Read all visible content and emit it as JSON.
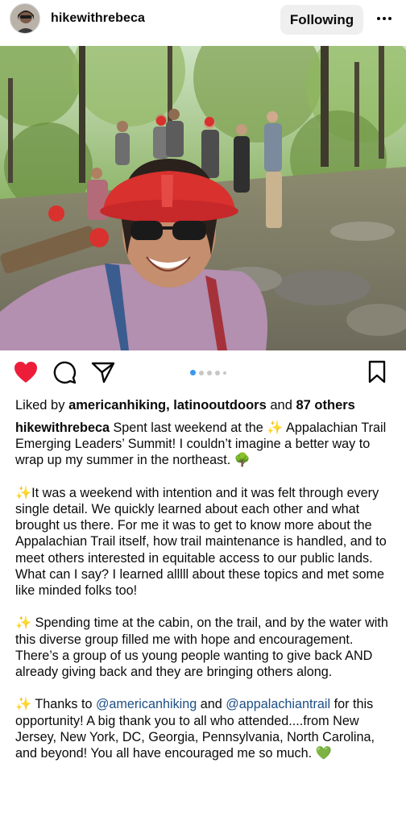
{
  "post": {
    "username": "hikewithrebeca",
    "follow_label": "Following",
    "more_icon": "more-horizontal-icon",
    "photo_description": "",
    "liked_prefix": "Liked by",
    "liked_users": "americanhiking, latinooutdoors",
    "liked_and": "and",
    "liked_others": "87 others",
    "carousel": {
      "count": 5,
      "active": 1
    },
    "colors": {
      "like_red": "#ed1d3a",
      "link_blue": "#1d4f86",
      "carousel_blue": "#3897f0",
      "button_bg": "#efefef"
    }
  },
  "caption": {
    "p1_user": "hikewithrebeca",
    "p1_a": "Spent last weekend at the",
    "p1_b": "Appalachian Trail Emerging Leaders’ Summit! I couldn’t imagine a better way to wrap up my summer in the northeast.",
    "p2": "It was a weekend with intention and it was felt through every single detail. We quickly learned about each other and what brought us there. For me it was to get to know more about the Appalachian Trail itself, how trail maintenance is handled, and to meet others interested in equitable access to our public lands. What can I say? I learned alllll about these topics and met some like minded folks too!",
    "p3": "Spending time at the cabin, on the trail, and by the water with this diverse group filled me with hope and encouragement. There’s a group of us young people wanting to give back AND already giving back and they are bringing others along.",
    "p4_a": "Thanks to",
    "p4_m1": "@americanhiking",
    "p4_and": "and",
    "p4_m2": "@appalachiantrail",
    "p4_b": "for this opportunity! A big thank you to all who attended....from New Jersey, New York, DC, Georgia, Pennsylvania, North Carolina, and beyond! You all have encouraged me so much.",
    "emoji_sparkles": "✨",
    "emoji_tree": "🌳",
    "emoji_green_heart": "💚"
  }
}
